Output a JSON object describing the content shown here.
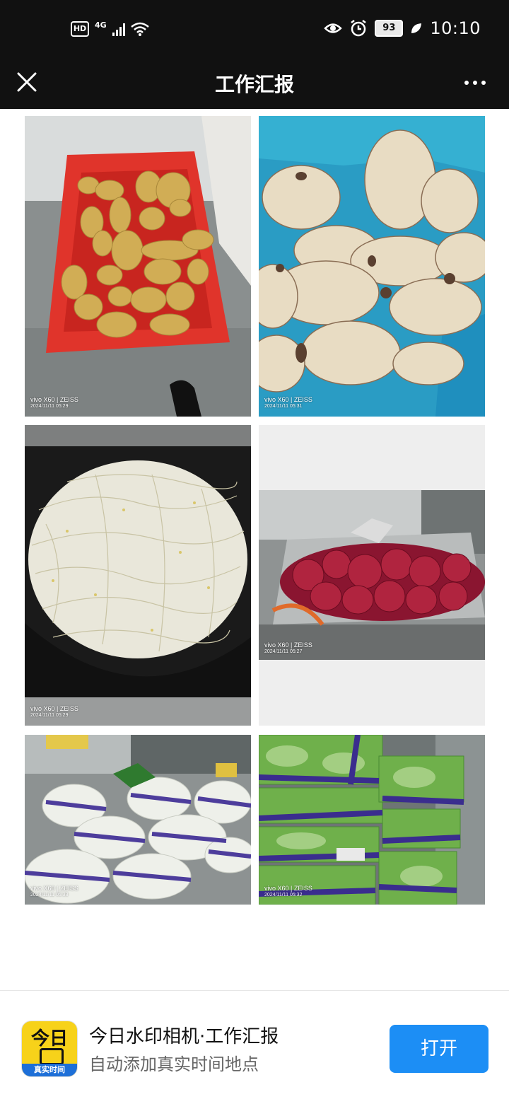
{
  "status_bar": {
    "hd": "HD",
    "network": "4G",
    "battery": "93",
    "time": "10:10"
  },
  "header": {
    "title": "工作汇报"
  },
  "photos": [
    {
      "subject": "potatoes in red crate",
      "watermark_brand": "vivo X60 | ZEISS",
      "watermark_date": "2024/11/11 05:29"
    },
    {
      "subject": "lotus roots",
      "watermark_brand": "vivo X60 | ZEISS",
      "watermark_date": "2024/11/11 05:31"
    },
    {
      "subject": "bean sprouts in black bag",
      "watermark_brand": "vivo X60 | ZEISS",
      "watermark_date": "2024/11/11 05:29"
    },
    {
      "subject": "red onions in mesh bag",
      "watermark_brand": "vivo X60 | ZEISS",
      "watermark_date": "2024/11/11 05:27"
    },
    {
      "subject": "bagged cauliflower",
      "watermark_brand": "vivo X60 | ZEISS",
      "watermark_date": "2024/11/11 05:33"
    },
    {
      "subject": "bagged bok choy",
      "watermark_brand": "vivo X60 | ZEISS",
      "watermark_date": "2024/11/11 05:32"
    }
  ],
  "banner": {
    "logo_text": "今日",
    "logo_strip": "真实时间",
    "title": "今日水印相机·工作汇报",
    "subtitle": "自动添加真实时间地点",
    "open_label": "打开"
  },
  "colors": {
    "header_bg": "#111111",
    "open_button": "#1c8ef5",
    "logo_yellow": "#f7d21a"
  }
}
